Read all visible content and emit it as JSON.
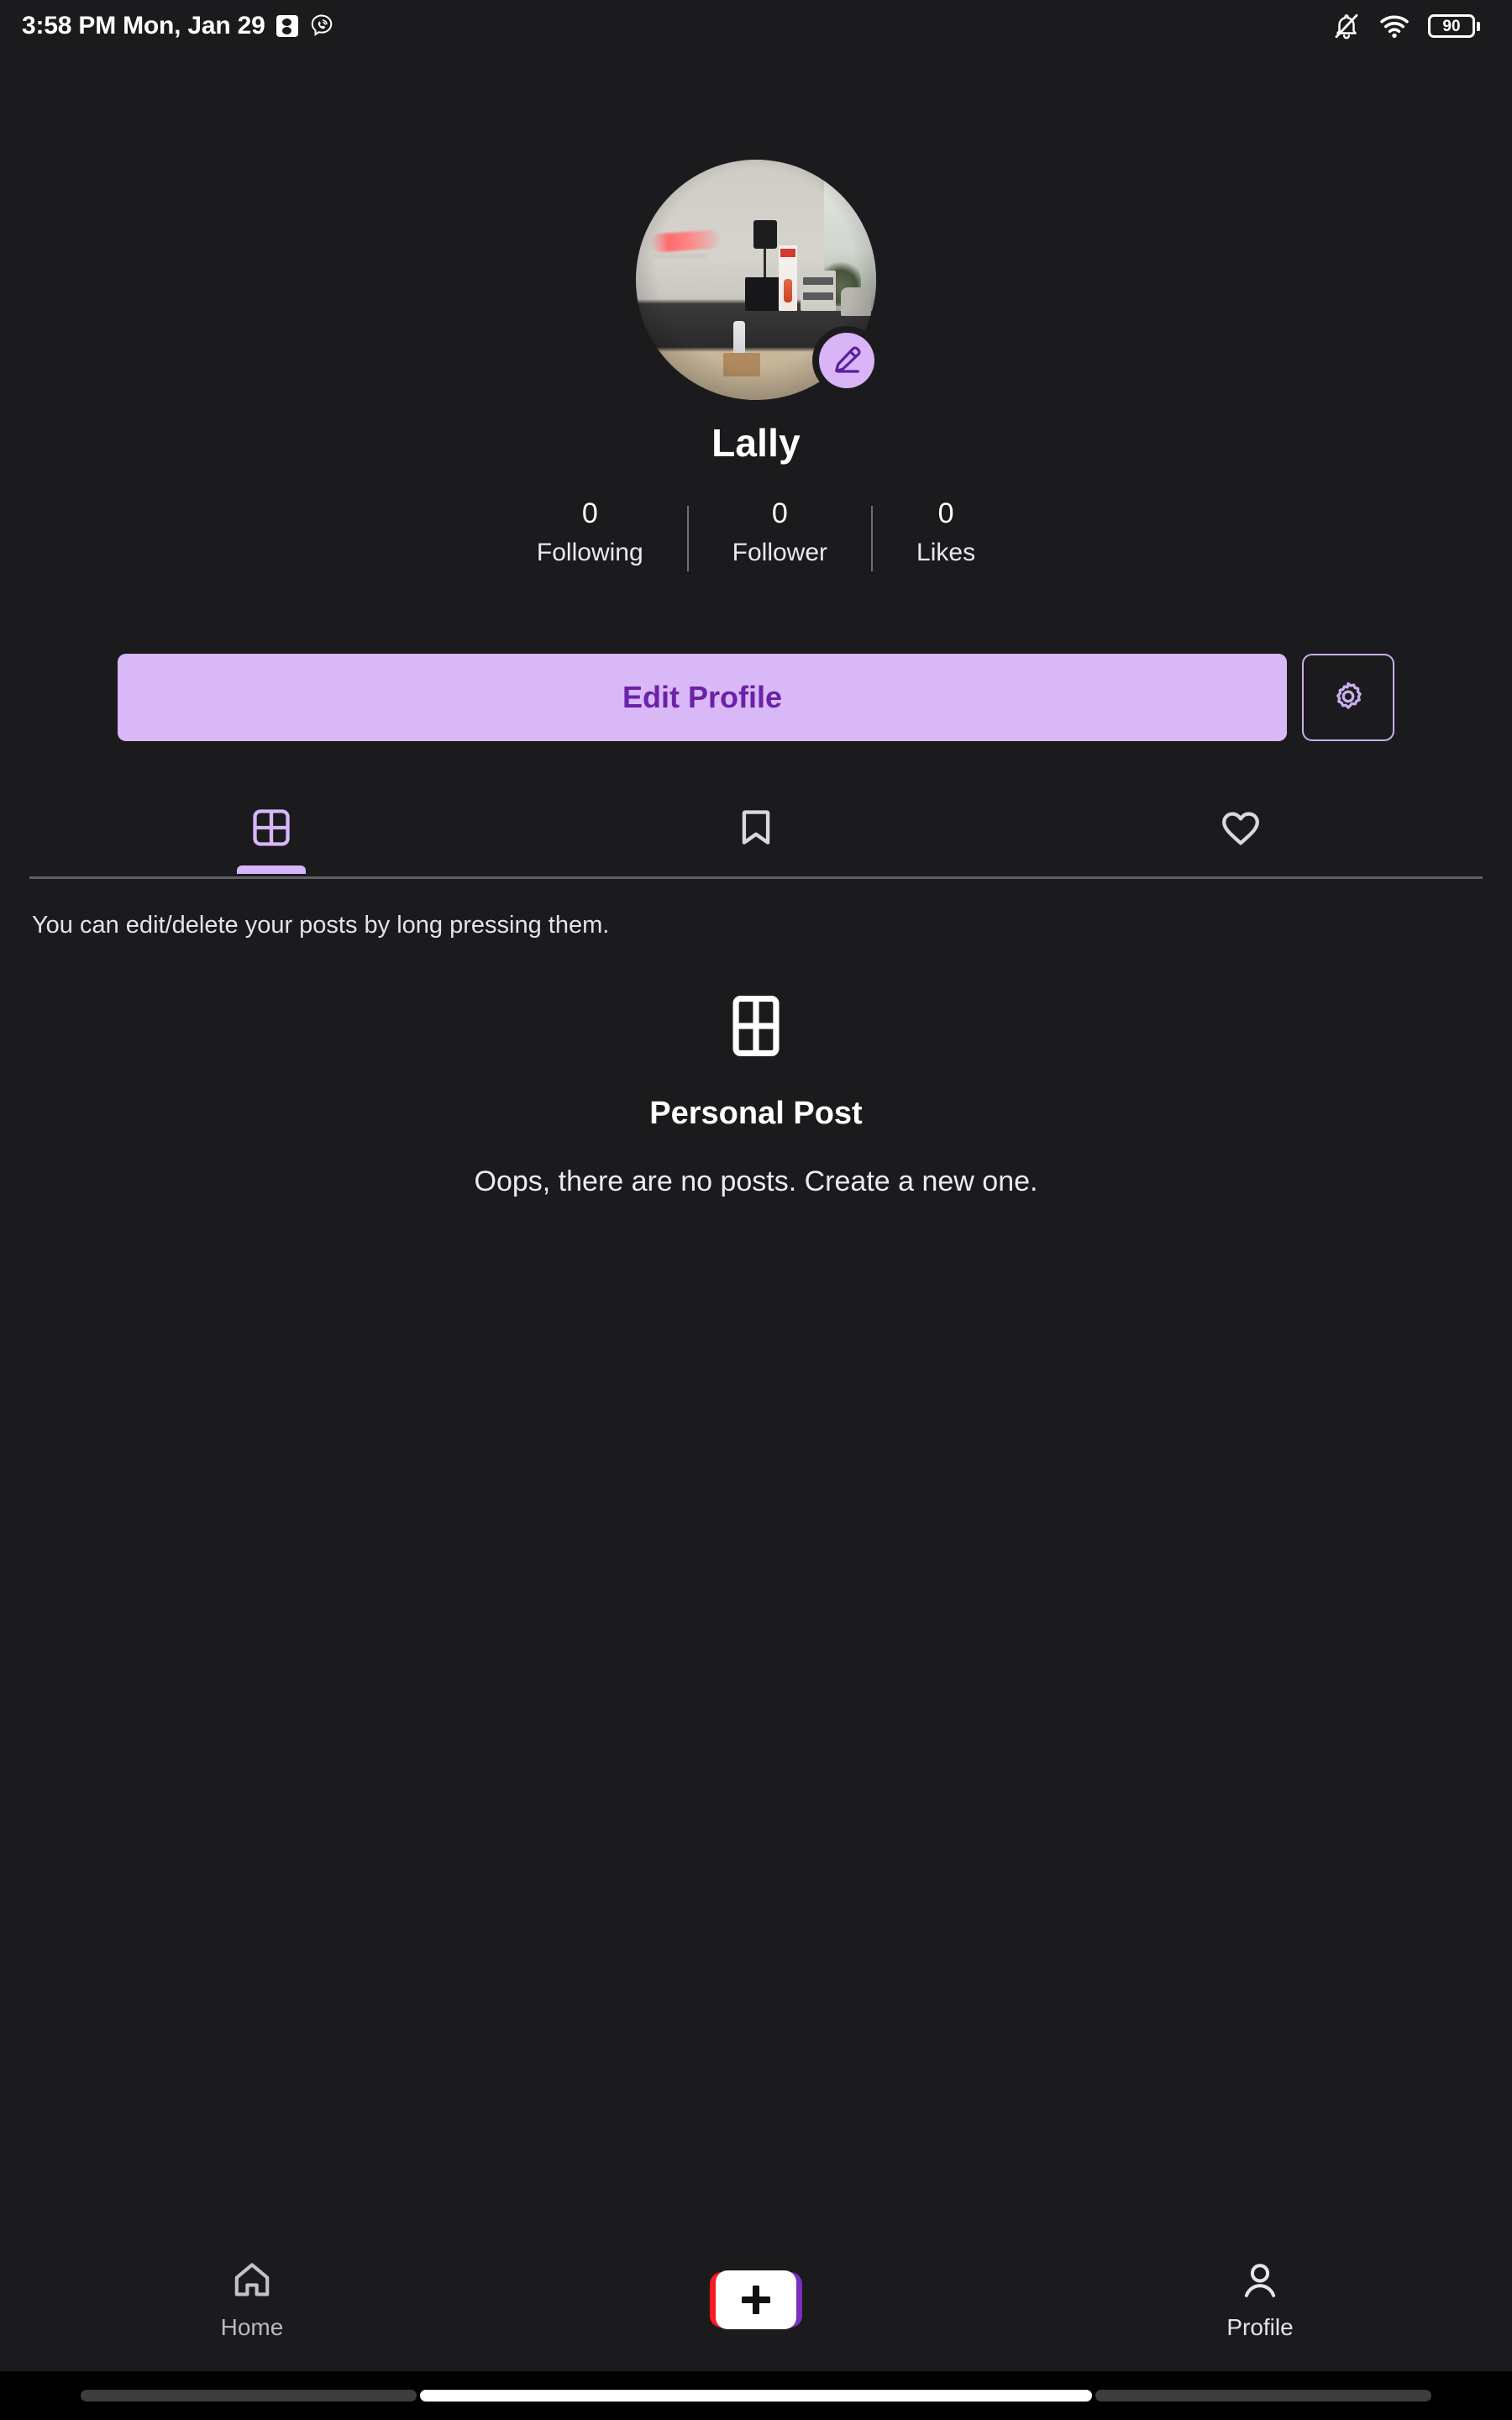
{
  "status_bar": {
    "clock": "3:58 PM Mon, Jan 29",
    "notification_icons": [
      "screenshot-badge-icon",
      "viber-icon"
    ],
    "right_icons": [
      "mute-bell-icon",
      "wifi-icon"
    ],
    "battery_level": "90"
  },
  "profile": {
    "avatar_alt": "profile-photo",
    "edit_avatar_icon": "pencil-icon",
    "display_name": "Lally",
    "stats": [
      {
        "value": "0",
        "label": "Following"
      },
      {
        "value": "0",
        "label": "Follower"
      },
      {
        "value": "0",
        "label": "Likes"
      }
    ]
  },
  "actions": {
    "edit_profile_label": "Edit Profile",
    "settings_icon": "gear-icon"
  },
  "tabs": [
    {
      "icon": "grid-icon",
      "active": true
    },
    {
      "icon": "bookmark-icon",
      "active": false
    },
    {
      "icon": "heart-icon",
      "active": false
    }
  ],
  "content": {
    "hint": "You can edit/delete your posts by long pressing them.",
    "empty_icon": "grid-icon",
    "empty_title": "Personal Post",
    "empty_subtitle": "Oops, there are no posts. Create a new one."
  },
  "bottom_nav": {
    "home_label": "Home",
    "home_icon": "home-icon",
    "create_icon": "plus-icon",
    "profile_label": "Profile",
    "profile_icon": "person-icon"
  },
  "colors": {
    "background": "#1b1b1d",
    "accent_light": "#d9b8f7",
    "accent_dark": "#6b21a8",
    "text_primary": "#ffffff",
    "text_secondary": "#b9b9c0",
    "create_red": "#fa1a25",
    "create_purple": "#7b2fbe"
  }
}
